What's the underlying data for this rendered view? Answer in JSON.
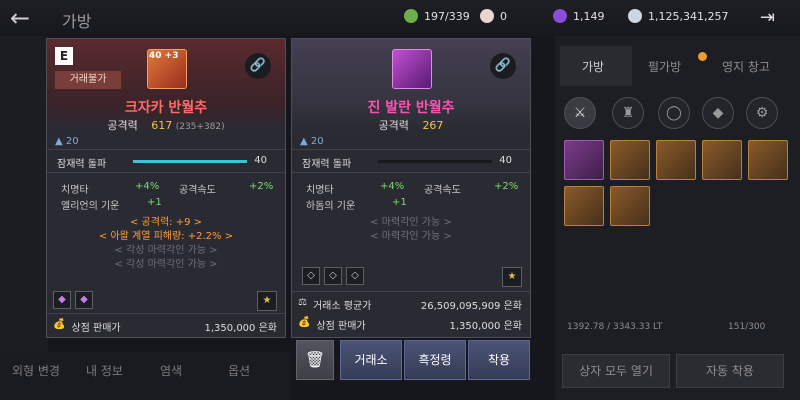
{
  "header": {
    "back_icon": "back-arrow-icon",
    "title": "가방",
    "currencies": [
      {
        "icon": "leaf-coin-icon",
        "color": "#6fae4a",
        "value": "197/339"
      },
      {
        "icon": "pearl-icon",
        "color": "#e9d6d0",
        "value": "0"
      },
      {
        "icon": "purple-orb-icon",
        "color": "#8a4bd6",
        "value": "1,149"
      },
      {
        "icon": "silver-coin-icon",
        "color": "#cfd6e3",
        "value": "1,125,341,257"
      }
    ],
    "exit_icon": "exit-door-icon"
  },
  "card_left": {
    "grade": "E",
    "trade_badge": "거래불가",
    "icon_level": "40 +3",
    "name": "크자카 반월추",
    "attack_label": "공격력",
    "attack_value": "617",
    "attack_sub": "(235+382)",
    "required_level": "20",
    "potential_label": "잠재력 돌파",
    "potential_value": "40",
    "potential_fill": 1.0,
    "stats": [
      {
        "label": "치명타",
        "value": "+4%"
      },
      {
        "label": "공격속도",
        "value": "+2%"
      },
      {
        "label": "엘리언의 기운",
        "value": "+1"
      }
    ],
    "bonus_lines": [
      "< 공격력: +9 >",
      "< 아왈 계열 피해량: +2.2% >"
    ],
    "awaken_lines": [
      "< 각성 마력각인 가능 >",
      "< 각성 마력각인 가능 >"
    ],
    "sell_label": "상점 판매가",
    "sell_value": "1,350,000 은화"
  },
  "card_right": {
    "icon_level": "",
    "name": "진 발란 반월추",
    "attack_label": "공격력",
    "attack_value": "267",
    "required_level": "20",
    "potential_label": "잠재력 돌파",
    "potential_value": "40",
    "potential_fill": 1.0,
    "stats": [
      {
        "label": "치명타",
        "value": "+4%"
      },
      {
        "label": "공격속도",
        "value": "+2%"
      },
      {
        "label": "하돔의 기운",
        "value": "+1"
      }
    ],
    "enchant_lines": [
      "< 마력각인 가능 >",
      "< 마력각인 가능 >"
    ],
    "market_label": "거래소 평균가",
    "market_value": "26,509,095,909 은화",
    "sell_label": "상점 판매가",
    "sell_value": "1,350,000 은화"
  },
  "actions": {
    "trash_icon": "trash-icon",
    "trade": "거래소",
    "black_spirit": "흑정령",
    "equip": "착용"
  },
  "left_bottom": {
    "tabs": [
      "외형 변경",
      "내 정보",
      "염색",
      "옵션"
    ]
  },
  "right_panel": {
    "tabs": [
      "가방",
      "펄가방",
      "영지 창고"
    ],
    "categories": [
      "crossed-swords-icon",
      "armor-icon",
      "ring-icon",
      "gem-icon",
      "potion-icon"
    ],
    "weight": "1392.78 / 3343.33 LT",
    "capacity": "151/300",
    "open_all": "상자 모두 열기",
    "auto_equip": "자동 착용"
  }
}
